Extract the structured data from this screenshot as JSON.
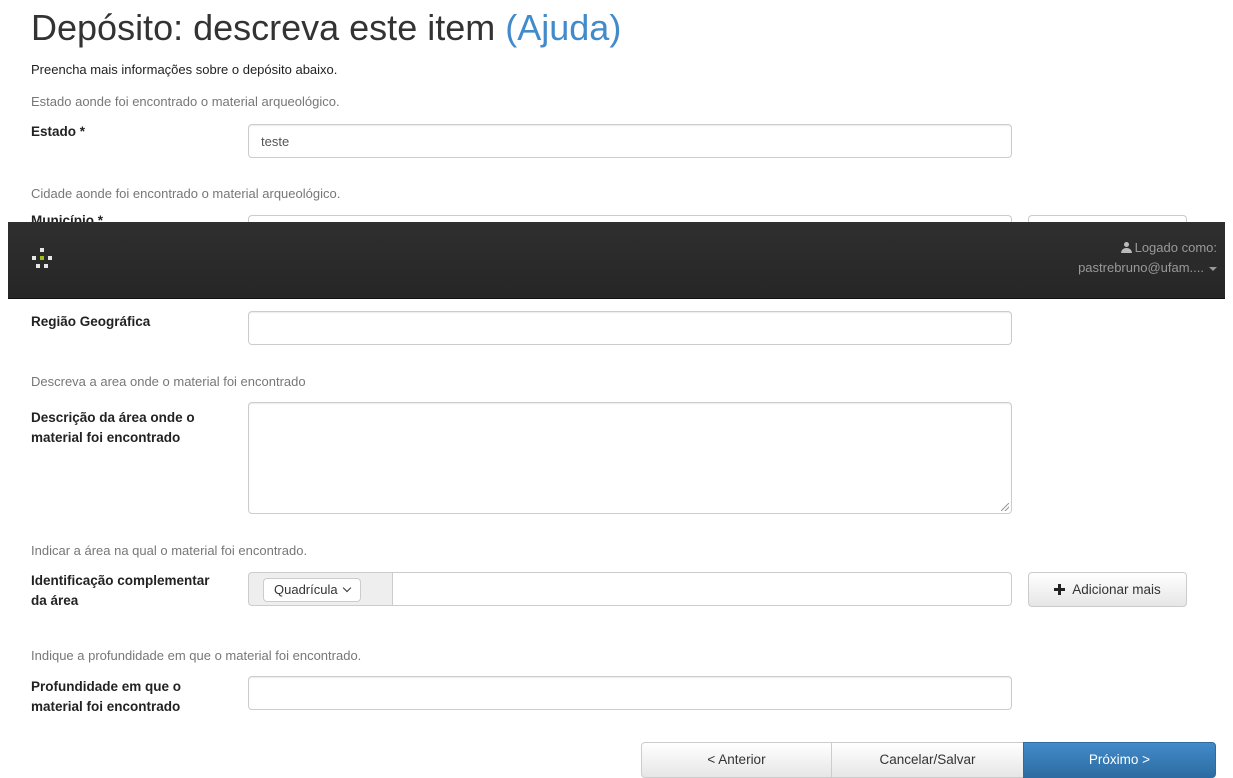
{
  "header": {
    "title": "Depósito: descreva este item",
    "help_link": "(Ajuda)",
    "intro": "Preencha mais informações sobre o depósito abaixo."
  },
  "fields": {
    "estado": {
      "hint": "Estado aonde foi encontrado o material arqueológico.",
      "label": "Estado *",
      "value": "teste"
    },
    "municipio": {
      "hint": "Cidade aonde foi encontrado o material arqueológico.",
      "label": "Município *"
    },
    "regiao": {
      "label": "Região Geográfica",
      "value": ""
    },
    "descricao": {
      "hint": "Descreva a area onde o material foi encontrado",
      "label": "Descrição da área onde o material foi encontrado",
      "value": ""
    },
    "identificacao": {
      "hint": "Indicar a área na qual o material foi encontrado.",
      "label": "Identificação complementar da área",
      "select_value": "Quadrícula",
      "value": "",
      "add_button": "Adicionar mais"
    },
    "profundidade": {
      "hint": "Indique a profundidade em que o material foi encontrado.",
      "label": "Profundidade em que o material foi encontrado",
      "value": ""
    }
  },
  "navbar": {
    "user_label": "Logado como:",
    "user_email": "pastrebruno@ufam...."
  },
  "actions": {
    "previous": "< Anterior",
    "cancel_save": "Cancelar/Salvar",
    "next": "Próximo >"
  },
  "colors": {
    "link": "#428bca",
    "navbar": "#2c2c2c",
    "primary": "#428bca",
    "brand_accent": "#9ac21a"
  },
  "icons": {
    "user": "user-icon",
    "caret": "caret-down-icon",
    "plus": "plus-icon",
    "chevron": "chevron-down-icon",
    "brand": "dspace-logo-icon"
  }
}
